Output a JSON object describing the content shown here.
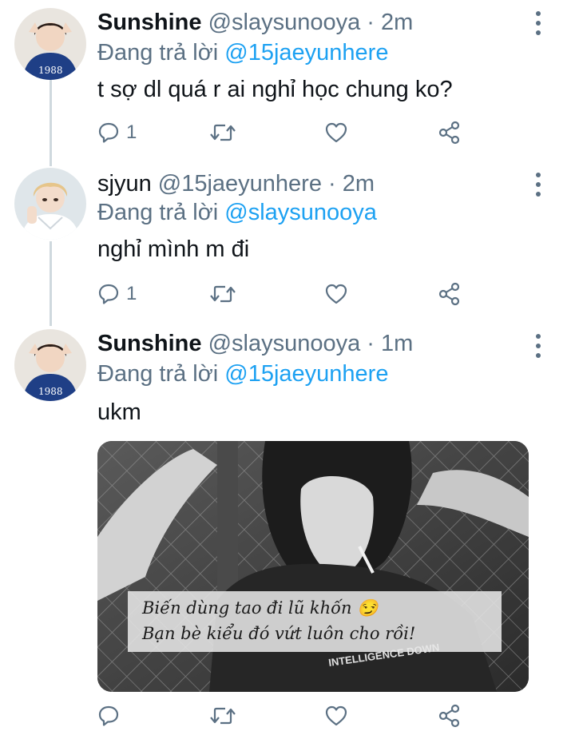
{
  "tweets": [
    {
      "name": "Sunshine",
      "handle": "@slaysunooya",
      "time": "2m",
      "reply_prefix": "Đang trả lời",
      "reply_mention": "@15jaeyunhere",
      "text": "t sợ dl quá r ai nghỉ học chung ko?",
      "reply_count": "1",
      "avatar_label": "1988"
    },
    {
      "name": "sjyun",
      "handle": "@15jaeyunhere",
      "time": "2m",
      "reply_prefix": "Đang trả lời",
      "reply_mention": "@slaysunooya",
      "text": "nghỉ mình m đi",
      "reply_count": "1"
    },
    {
      "name": "Sunshine",
      "handle": "@slaysunooya",
      "time": "1m",
      "reply_prefix": "Đang trả lời",
      "reply_mention": "@15jaeyunhere",
      "text": "ukm",
      "reply_count": "",
      "avatar_label": "1988",
      "media": {
        "caption_line1": "Biến dùng tao đi lũ khốn 😏",
        "caption_line2": "Bạn bè kiểu đó vứt luôn cho rồi!",
        "shirt_text": "INTELLIGENCE DOWN"
      }
    }
  ],
  "separator": "·",
  "colors": {
    "name": "#0f1419",
    "secondary": "#5b7083",
    "mention": "#1da1f2",
    "thread_line": "#cfd9de"
  },
  "icons": [
    "reply-icon",
    "retweet-icon",
    "like-icon",
    "share-icon",
    "more-options-icon"
  ]
}
